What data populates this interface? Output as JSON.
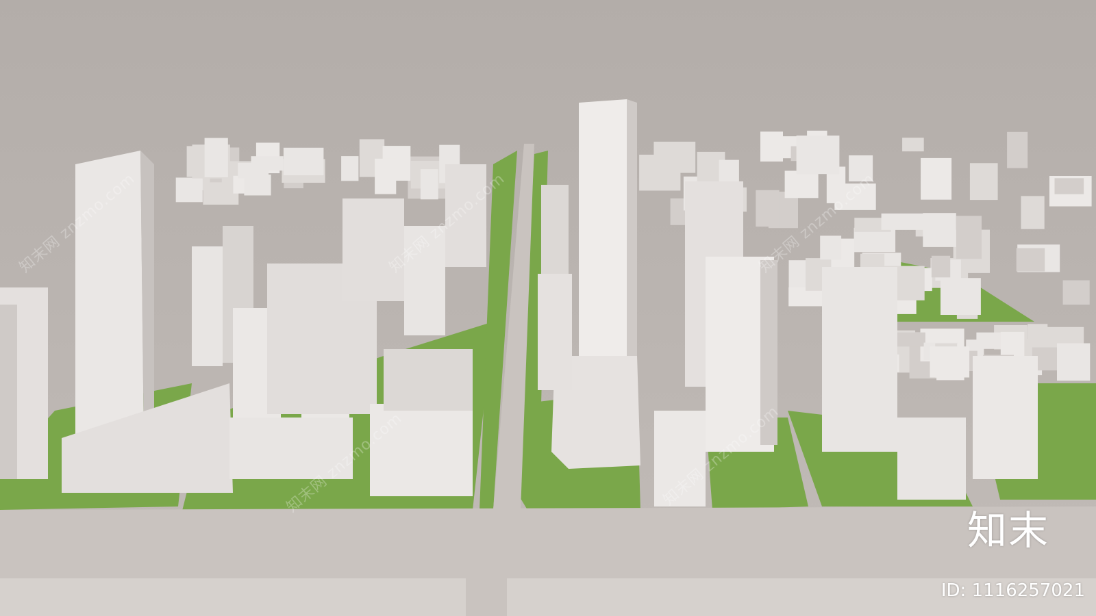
{
  "watermark": {
    "site": "znzmo.com",
    "site_cn": "知末网",
    "brand": "知末",
    "image_id": "ID: 1116257021"
  },
  "colors": {
    "sky": "#bbb5b1",
    "ground": "#bdb7b3",
    "road": "#c8c2be",
    "grass": "#7aa74a",
    "building_light": "#ece9e7",
    "building_mid": "#d9d5d3",
    "building_shadow": "#b9b4b1"
  }
}
